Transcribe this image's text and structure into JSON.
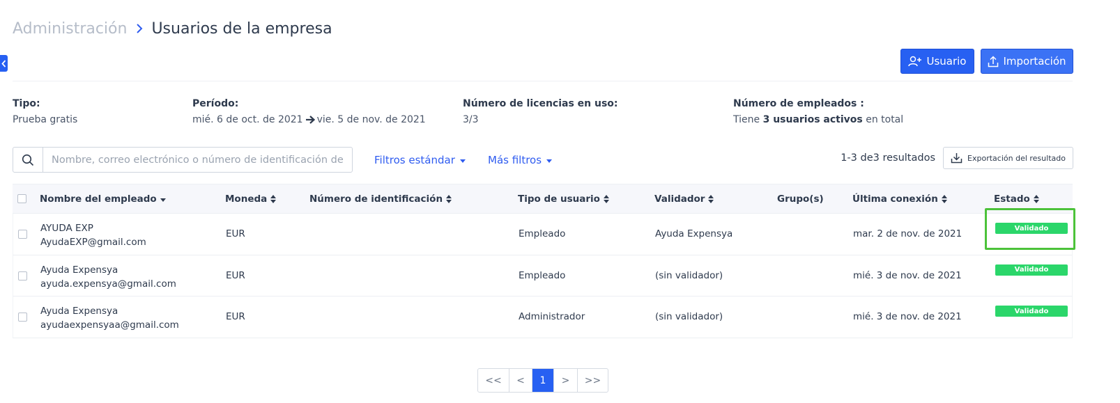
{
  "breadcrumb": {
    "parent": "Administración",
    "current": "Usuarios de la empresa"
  },
  "actions": {
    "add_user": "Usuario",
    "import": "Importación"
  },
  "info": {
    "tipo_label": "Tipo:",
    "tipo_value": "Prueba gratis",
    "periodo_label": "Período:",
    "periodo_start": "mié. 6 de oct. de 2021",
    "periodo_end": "vie. 5 de nov. de 2021",
    "licencias_label": "Número de licencias en uso:",
    "licencias_value": "3/3",
    "empleados_label": "Número de empleados :",
    "empleados_prefix": "Tiene",
    "empleados_bold": "3 usuarios activos",
    "empleados_suffix": "en total"
  },
  "search": {
    "placeholder": "Nombre, correo electrónico o número de identificación del",
    "value": ""
  },
  "filters": {
    "standard": "Filtros estándar",
    "more": "Más filtros"
  },
  "results": {
    "text": "1-3 de3 resultados",
    "export": "Exportación del resultado"
  },
  "table": {
    "headers": {
      "name": "Nombre del empleado",
      "currency": "Moneda",
      "id_number": "Número de identificación",
      "user_type": "Tipo de usuario",
      "validator": "Validador",
      "groups": "Grupo(s)",
      "last_login": "Última conexión",
      "status": "Estado"
    },
    "rows": [
      {
        "name": "AYUDA EXP",
        "email": "AyudaEXP@gmail.com",
        "currency": "EUR",
        "id_number": "",
        "user_type": "Empleado",
        "validator": "Ayuda Expensya",
        "groups": "",
        "last_login": "mar. 2 de nov. de 2021",
        "status": "Validado"
      },
      {
        "name": "Ayuda Expensya",
        "email": "ayuda.expensya@gmail.com",
        "currency": "EUR",
        "id_number": "",
        "user_type": "Empleado",
        "validator": "(sin validador)",
        "groups": "",
        "last_login": "mié. 3 de nov. de 2021",
        "status": "Validado"
      },
      {
        "name": "Ayuda Expensya",
        "email": "ayudaexpensyaa@gmail.com",
        "currency": "EUR",
        "id_number": "",
        "user_type": "Administrador",
        "validator": "(sin validador)",
        "groups": "",
        "last_login": "mié. 3 de nov. de 2021",
        "status": "Validado"
      }
    ]
  },
  "pagination": {
    "first": "<<",
    "prev": "<",
    "current": "1",
    "next": ">",
    "last": ">>"
  },
  "colors": {
    "primary": "#2760f2",
    "status_green": "#2bd66a",
    "highlight_green": "#4cc23a",
    "link": "#2f5cf0"
  }
}
